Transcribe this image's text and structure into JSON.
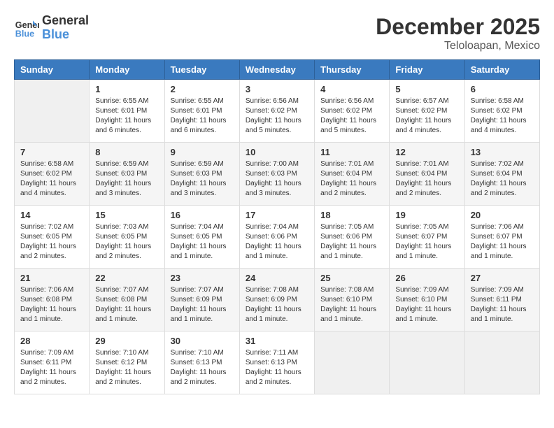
{
  "header": {
    "logo_line1": "General",
    "logo_line2": "Blue",
    "month": "December 2025",
    "location": "Teloloapan, Mexico"
  },
  "days_of_week": [
    "Sunday",
    "Monday",
    "Tuesday",
    "Wednesday",
    "Thursday",
    "Friday",
    "Saturday"
  ],
  "weeks": [
    [
      {
        "day": "",
        "info": ""
      },
      {
        "day": "1",
        "info": "Sunrise: 6:55 AM\nSunset: 6:01 PM\nDaylight: 11 hours\nand 6 minutes."
      },
      {
        "day": "2",
        "info": "Sunrise: 6:55 AM\nSunset: 6:01 PM\nDaylight: 11 hours\nand 6 minutes."
      },
      {
        "day": "3",
        "info": "Sunrise: 6:56 AM\nSunset: 6:02 PM\nDaylight: 11 hours\nand 5 minutes."
      },
      {
        "day": "4",
        "info": "Sunrise: 6:56 AM\nSunset: 6:02 PM\nDaylight: 11 hours\nand 5 minutes."
      },
      {
        "day": "5",
        "info": "Sunrise: 6:57 AM\nSunset: 6:02 PM\nDaylight: 11 hours\nand 4 minutes."
      },
      {
        "day": "6",
        "info": "Sunrise: 6:58 AM\nSunset: 6:02 PM\nDaylight: 11 hours\nand 4 minutes."
      }
    ],
    [
      {
        "day": "7",
        "info": "Sunrise: 6:58 AM\nSunset: 6:02 PM\nDaylight: 11 hours\nand 4 minutes."
      },
      {
        "day": "8",
        "info": "Sunrise: 6:59 AM\nSunset: 6:03 PM\nDaylight: 11 hours\nand 3 minutes."
      },
      {
        "day": "9",
        "info": "Sunrise: 6:59 AM\nSunset: 6:03 PM\nDaylight: 11 hours\nand 3 minutes."
      },
      {
        "day": "10",
        "info": "Sunrise: 7:00 AM\nSunset: 6:03 PM\nDaylight: 11 hours\nand 3 minutes."
      },
      {
        "day": "11",
        "info": "Sunrise: 7:01 AM\nSunset: 6:04 PM\nDaylight: 11 hours\nand 2 minutes."
      },
      {
        "day": "12",
        "info": "Sunrise: 7:01 AM\nSunset: 6:04 PM\nDaylight: 11 hours\nand 2 minutes."
      },
      {
        "day": "13",
        "info": "Sunrise: 7:02 AM\nSunset: 6:04 PM\nDaylight: 11 hours\nand 2 minutes."
      }
    ],
    [
      {
        "day": "14",
        "info": "Sunrise: 7:02 AM\nSunset: 6:05 PM\nDaylight: 11 hours\nand 2 minutes."
      },
      {
        "day": "15",
        "info": "Sunrise: 7:03 AM\nSunset: 6:05 PM\nDaylight: 11 hours\nand 2 minutes."
      },
      {
        "day": "16",
        "info": "Sunrise: 7:04 AM\nSunset: 6:05 PM\nDaylight: 11 hours\nand 1 minute."
      },
      {
        "day": "17",
        "info": "Sunrise: 7:04 AM\nSunset: 6:06 PM\nDaylight: 11 hours\nand 1 minute."
      },
      {
        "day": "18",
        "info": "Sunrise: 7:05 AM\nSunset: 6:06 PM\nDaylight: 11 hours\nand 1 minute."
      },
      {
        "day": "19",
        "info": "Sunrise: 7:05 AM\nSunset: 6:07 PM\nDaylight: 11 hours\nand 1 minute."
      },
      {
        "day": "20",
        "info": "Sunrise: 7:06 AM\nSunset: 6:07 PM\nDaylight: 11 hours\nand 1 minute."
      }
    ],
    [
      {
        "day": "21",
        "info": "Sunrise: 7:06 AM\nSunset: 6:08 PM\nDaylight: 11 hours\nand 1 minute."
      },
      {
        "day": "22",
        "info": "Sunrise: 7:07 AM\nSunset: 6:08 PM\nDaylight: 11 hours\nand 1 minute."
      },
      {
        "day": "23",
        "info": "Sunrise: 7:07 AM\nSunset: 6:09 PM\nDaylight: 11 hours\nand 1 minute."
      },
      {
        "day": "24",
        "info": "Sunrise: 7:08 AM\nSunset: 6:09 PM\nDaylight: 11 hours\nand 1 minute."
      },
      {
        "day": "25",
        "info": "Sunrise: 7:08 AM\nSunset: 6:10 PM\nDaylight: 11 hours\nand 1 minute."
      },
      {
        "day": "26",
        "info": "Sunrise: 7:09 AM\nSunset: 6:10 PM\nDaylight: 11 hours\nand 1 minute."
      },
      {
        "day": "27",
        "info": "Sunrise: 7:09 AM\nSunset: 6:11 PM\nDaylight: 11 hours\nand 1 minute."
      }
    ],
    [
      {
        "day": "28",
        "info": "Sunrise: 7:09 AM\nSunset: 6:11 PM\nDaylight: 11 hours\nand 2 minutes."
      },
      {
        "day": "29",
        "info": "Sunrise: 7:10 AM\nSunset: 6:12 PM\nDaylight: 11 hours\nand 2 minutes."
      },
      {
        "day": "30",
        "info": "Sunrise: 7:10 AM\nSunset: 6:13 PM\nDaylight: 11 hours\nand 2 minutes."
      },
      {
        "day": "31",
        "info": "Sunrise: 7:11 AM\nSunset: 6:13 PM\nDaylight: 11 hours\nand 2 minutes."
      },
      {
        "day": "",
        "info": ""
      },
      {
        "day": "",
        "info": ""
      },
      {
        "day": "",
        "info": ""
      }
    ]
  ]
}
